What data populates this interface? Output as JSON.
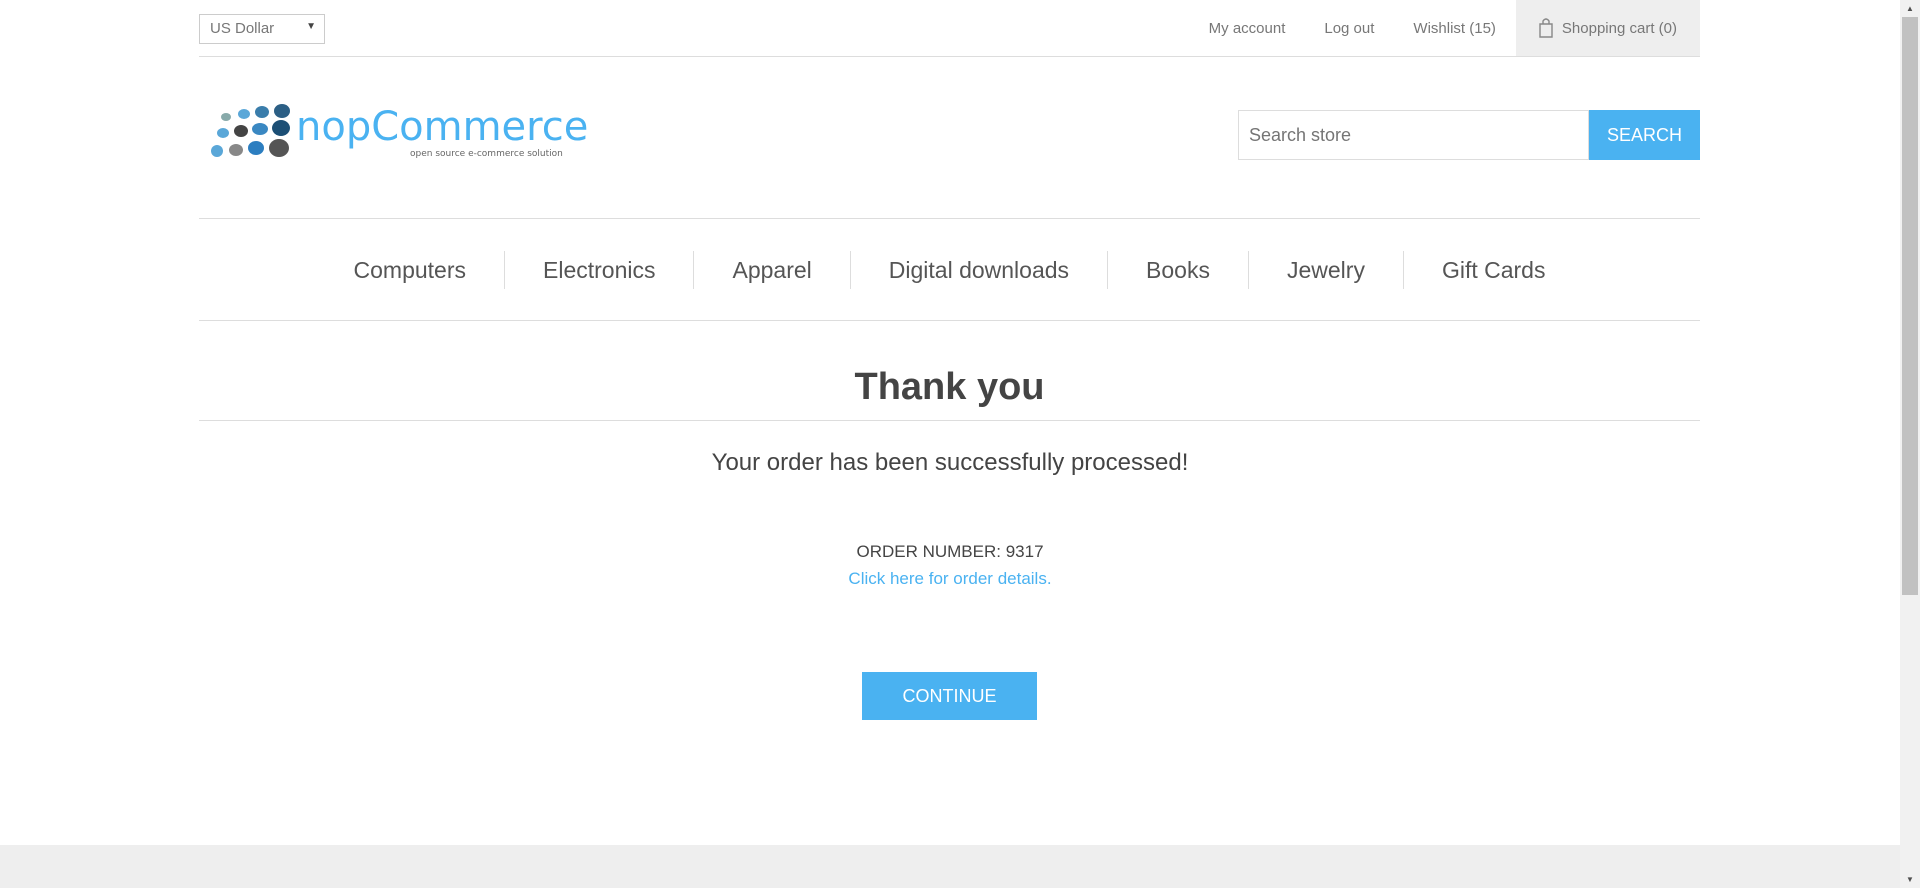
{
  "header": {
    "currency": "US Dollar",
    "links": {
      "my_account": "My account",
      "log_out": "Log out",
      "wishlist": "Wishlist (15)",
      "cart": "Shopping cart (0)"
    }
  },
  "logo": {
    "brand": "nopCommerce",
    "tagline": "open source e-commerce solution"
  },
  "search": {
    "placeholder": "Search store",
    "button": "SEARCH"
  },
  "menu": {
    "items": [
      "Computers",
      "Electronics",
      "Apparel",
      "Digital downloads",
      "Books",
      "Jewelry",
      "Gift Cards"
    ]
  },
  "content": {
    "title": "Thank you",
    "message": "Your order has been successfully processed!",
    "order_number": "ORDER NUMBER: 9317",
    "order_details_link": "Click here for order details.",
    "continue_button": "CONTINUE"
  },
  "colors": {
    "accent": "#4ab2f1",
    "text": "#444444",
    "muted": "#777777",
    "border": "#dddddd",
    "cart_bg": "#eeeeee"
  }
}
